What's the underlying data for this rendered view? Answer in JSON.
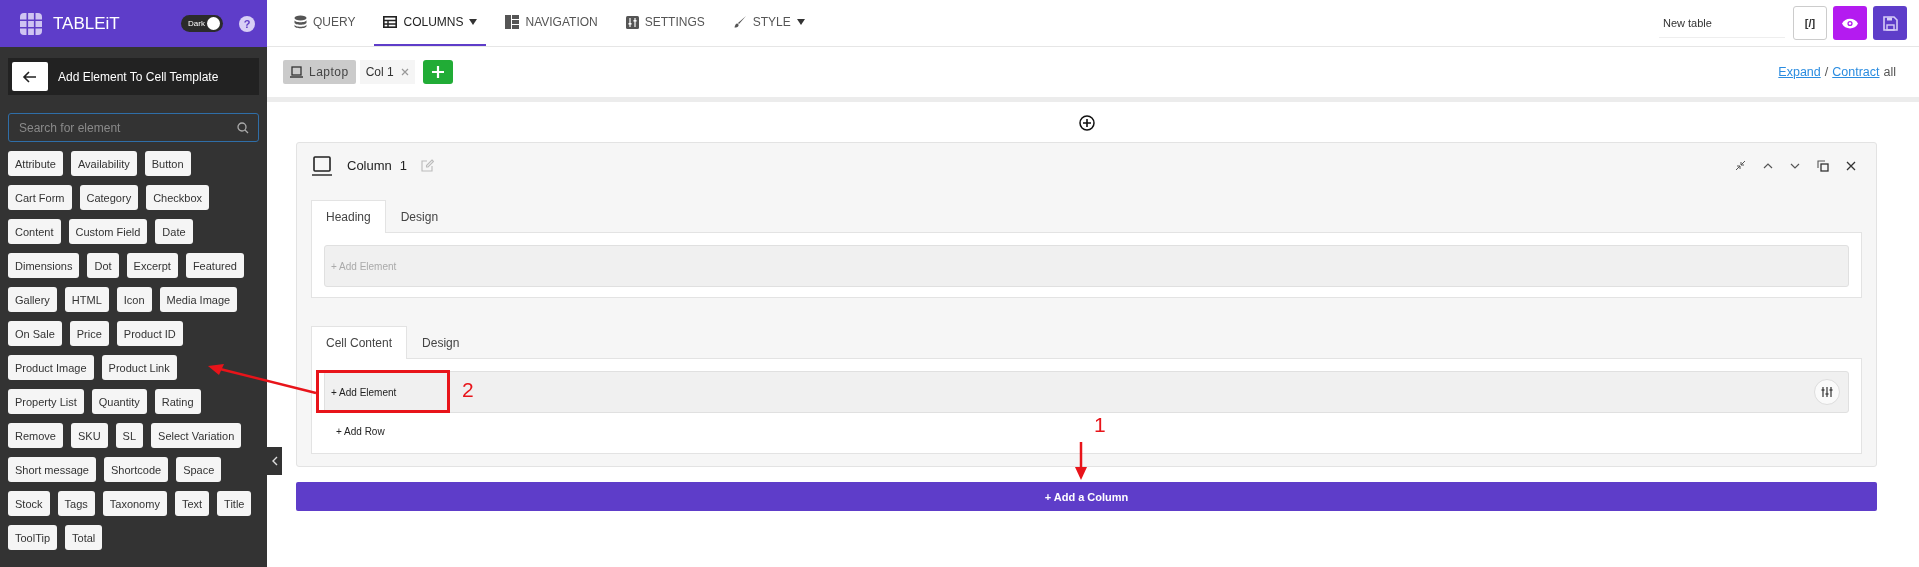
{
  "app": {
    "name": "TABLEiT",
    "theme_toggle": {
      "label": "Dark",
      "on": true
    },
    "help": "?"
  },
  "sidebar": {
    "back_title": "Add Element To Cell Template",
    "search": {
      "placeholder": "Search for element"
    },
    "elements": [
      "Attribute",
      "Availability",
      "Button",
      "Cart Form",
      "Category",
      "Checkbox",
      "Content",
      "Custom Field",
      "Date",
      "Dimensions",
      "Dot",
      "Excerpt",
      "Featured",
      "Gallery",
      "HTML",
      "Icon",
      "Media Image",
      "On Sale",
      "Price",
      "Product ID",
      "Product Image",
      "Product Link",
      "Property List",
      "Quantity",
      "Rating",
      "Remove",
      "SKU",
      "SL",
      "Select Variation",
      "Short message",
      "Shortcode",
      "Space",
      "Stock",
      "Tags",
      "Taxonomy",
      "Text",
      "Title",
      "ToolTip",
      "Total"
    ]
  },
  "nav_tabs": [
    {
      "label": "QUERY",
      "kind": "database",
      "selected": false,
      "dropdown": false
    },
    {
      "label": "COLUMNS",
      "kind": "table",
      "selected": true,
      "dropdown": true
    },
    {
      "label": "NAVIGATION",
      "kind": "layout",
      "selected": false,
      "dropdown": false
    },
    {
      "label": "SETTINGS",
      "kind": "sliders",
      "selected": false,
      "dropdown": false
    },
    {
      "label": "STYLE",
      "kind": "brush",
      "selected": false,
      "dropdown": true
    }
  ],
  "table_name": "New table",
  "code_button": "[/]",
  "devices": [
    {
      "label": "Laptop",
      "selected": true
    }
  ],
  "column_chips": [
    {
      "label": "Col 1"
    }
  ],
  "expand_links": {
    "expand": "Expand",
    "separator": "/",
    "contract": "Contract",
    "suffix": "all"
  },
  "column": {
    "title": "Column",
    "number": "1",
    "sections": [
      {
        "tabs": [
          {
            "label": "Heading",
            "selected": true
          },
          {
            "label": "Design",
            "selected": false
          }
        ],
        "add_element": "+ Add Element",
        "active": false
      },
      {
        "tabs": [
          {
            "label": "Cell Content",
            "selected": true
          },
          {
            "label": "Design",
            "selected": false
          }
        ],
        "add_element": "+ Add Element",
        "active": true,
        "add_row": "+ Add Row"
      }
    ]
  },
  "add_column": "+ Add a Column",
  "annotations": [
    {
      "label": "1"
    },
    {
      "label": "2"
    }
  ]
}
